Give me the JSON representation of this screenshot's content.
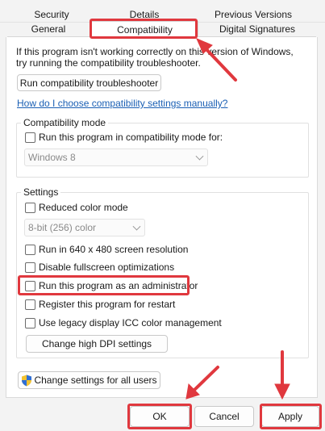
{
  "tabs": {
    "row1": [
      "Security",
      "Details",
      "Previous Versions"
    ],
    "row2": [
      "General",
      "Compatibility",
      "Digital Signatures"
    ],
    "active": "Compatibility"
  },
  "intro": {
    "line1": "If this program isn't working correctly on this version of Windows,",
    "line2": "try running the compatibility troubleshooter."
  },
  "buttons": {
    "troubleshooter": "Run compatibility troubleshooter",
    "change_dpi": "Change high DPI settings",
    "change_all_users": "Change settings for all users",
    "ok": "OK",
    "cancel": "Cancel",
    "apply": "Apply"
  },
  "link": "How do I choose compatibility settings manually?",
  "compat_mode": {
    "title": "Compatibility mode",
    "checkbox": "Run this program in compatibility mode for:",
    "selected": "Windows 8"
  },
  "settings": {
    "title": "Settings",
    "reduced_color": "Reduced color mode",
    "color_selected": "8-bit (256) color",
    "res_640": "Run in 640 x 480 screen resolution",
    "disable_fullscreen": "Disable fullscreen optimizations",
    "run_admin": "Run this program as an administrator",
    "register_restart": "Register this program for restart",
    "legacy_icc": "Use legacy display ICC color management"
  },
  "colors": {
    "highlight": "#e0383e",
    "link": "#1a5fb4"
  },
  "icons": {
    "uac": "shield-icon"
  }
}
